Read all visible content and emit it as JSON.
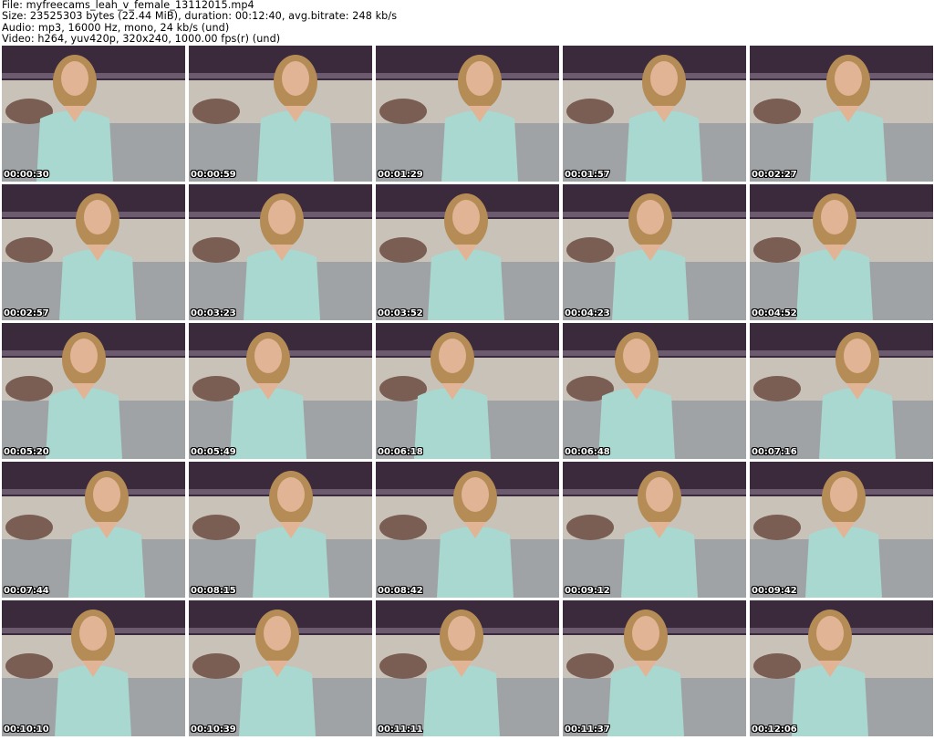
{
  "header": {
    "line1": "File: myfreecams_leah_v_female_13112015.mp4",
    "line2": "Size: 23525303 bytes (22.44 MiB), duration: 00:12:40, avg.bitrate: 248 kb/s",
    "line3": "Audio: mp3, 16000 Hz, mono, 24 kb/s (und)",
    "line4": "Video: h264, yuv420p, 320x240, 1000.00 fps(r) (und)"
  },
  "thumbnails": [
    {
      "timestamp": "00:00:30"
    },
    {
      "timestamp": "00:00:59"
    },
    {
      "timestamp": "00:01:29"
    },
    {
      "timestamp": "00:01:57"
    },
    {
      "timestamp": "00:02:27"
    },
    {
      "timestamp": "00:02:57"
    },
    {
      "timestamp": "00:03:23"
    },
    {
      "timestamp": "00:03:52"
    },
    {
      "timestamp": "00:04:23"
    },
    {
      "timestamp": "00:04:52"
    },
    {
      "timestamp": "00:05:20"
    },
    {
      "timestamp": "00:05:49"
    },
    {
      "timestamp": "00:06:18"
    },
    {
      "timestamp": "00:06:48"
    },
    {
      "timestamp": "00:07:16"
    },
    {
      "timestamp": "00:07:44"
    },
    {
      "timestamp": "00:08:15"
    },
    {
      "timestamp": "00:08:42"
    },
    {
      "timestamp": "00:09:12"
    },
    {
      "timestamp": "00:09:42"
    },
    {
      "timestamp": "00:10:10"
    },
    {
      "timestamp": "00:10:39"
    },
    {
      "timestamp": "00:11:11"
    },
    {
      "timestamp": "00:11:37"
    },
    {
      "timestamp": "00:12:06"
    }
  ],
  "colors": {
    "wall": "#c9c2b8",
    "tapestry": "#3a2a3c",
    "bedding": "#9fa3a6",
    "shirt": "#a9d8d0",
    "skin": "#e2b496",
    "hair": "#b58c55"
  }
}
